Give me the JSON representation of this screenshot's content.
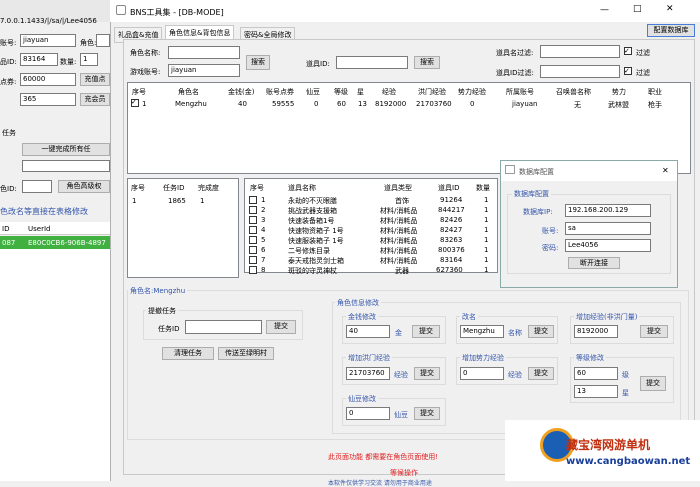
{
  "bg_window": {
    "row_ip": "7.0.0.1.1433/|/sa/|/Lee4056",
    "label_acct": "账号:",
    "acct_value": "jiayuan",
    "label_role": "角色:",
    "label_item": "品ID:",
    "item_id": "83164",
    "label_qty": "数量:",
    "qty_value": "1",
    "label_points": "点券:",
    "points_value": "60000",
    "btn_points": "充值点",
    "value_365": "365",
    "btn_charge": "充会员",
    "label_task": "任务",
    "btn_complete_all": "一键完成所有任",
    "label_roleid": "色ID:",
    "btn_role_advanced": "角色高级权",
    "tip": "色改名等直接在表格修改",
    "col_id": "ID",
    "col_userid": "UserId",
    "row_id": "087",
    "row_userid": "E80C0CB6-906B-4897"
  },
  "window": {
    "title": "BNS工具集 - [DB-MODE]",
    "btn_config_db": "配置数据库",
    "min": "—",
    "max": "□",
    "close": "✕"
  },
  "tabs": [
    {
      "label": "礼品盒&充值"
    },
    {
      "label": "角色信息&背包信息"
    },
    {
      "label": "密码&全局修改"
    }
  ],
  "search": {
    "label_role": "角色名称:",
    "label_account": "游戏账号:",
    "account_value": "jiayuan",
    "btn_search": "搜索",
    "label_itemid": "道具ID:",
    "btn_search2": "搜索",
    "label_name_filter": "道具名过滤:",
    "label_id_filter": "道具ID过滤:",
    "filter_chk": "过滤",
    "filter_chk2": "过滤"
  },
  "role_table": {
    "headers": [
      "序号",
      "角色名",
      "金钱(金)",
      "账号点券",
      "仙豆",
      "等级",
      "星",
      "经验",
      "洪门经验",
      "势力经验",
      "所属账号",
      "召唤兽名称",
      "势力",
      "职业"
    ],
    "rows": [
      [
        "1",
        "Mengzhu",
        "40",
        "59555",
        "0",
        "60",
        "13",
        "8192000",
        "21703760",
        "0",
        "jiayuan",
        "无",
        "武林盟",
        "枪手"
      ]
    ]
  },
  "task_table": {
    "headers": [
      "序号",
      "任务ID",
      "完成度"
    ],
    "rows": [
      [
        "1",
        "1865",
        "1"
      ]
    ]
  },
  "item_table": {
    "headers": [
      "序号",
      "道具名称",
      "道具类型",
      "道具ID",
      "数量"
    ],
    "rows": [
      [
        "1",
        "永劫的不灭眼膳",
        "首饰",
        "91264",
        "1"
      ],
      [
        "2",
        "挑战武器支援箱",
        "材料/消耗品",
        "844217",
        "1"
      ],
      [
        "3",
        "快速装备箱1号",
        "材料/消耗品",
        "82426",
        "1"
      ],
      [
        "4",
        "快速物资箱子 1号",
        "材料/消耗品",
        "82427",
        "1"
      ],
      [
        "5",
        "快速服装箱子 1号",
        "材料/消耗品",
        "83263",
        "1"
      ],
      [
        "6",
        "二号修炼目录",
        "材料/消耗品",
        "800376",
        "1"
      ],
      [
        "7",
        "泰天戒指灵剑士箱",
        "材料/消耗品",
        "83164",
        "1"
      ],
      [
        "8",
        "斑驳的守灵神杖",
        "武器",
        "627360",
        "1"
      ]
    ]
  },
  "dialog": {
    "title": "数据库配置",
    "group": "数据库配置",
    "label_ip": "数据库IP:",
    "ip_value": "192.168.200.129",
    "label_acct": "账号:",
    "acct_value": "sa",
    "label_pwd": "密码:",
    "pwd_value": "Lee4056",
    "btn_disconnect": "断开连接",
    "close": "✕"
  },
  "role_edit": {
    "group_label": "角色名:Mengzhu",
    "task_group": "提撤任务",
    "label_taskid": "任务ID",
    "btn_submit_task": "提交",
    "btn_clear_tasks": "清理任务",
    "btn_teleport": "传送至绿明村",
    "info_group": "角色信息修改",
    "money_label": "金钱修改",
    "money_value": "40",
    "money_unit": "金",
    "btn_money": "提交",
    "rename_label": "改名",
    "rename_value": "Mengzhu",
    "rename_unit": "名称",
    "btn_rename": "提交",
    "exp_label": "增加经验(非洪门量)",
    "exp_value": "8192000",
    "btn_exp": "提交",
    "hong_label": "增加洪门经验",
    "hong_value": "21703760",
    "hong_unit": "经验",
    "btn_hong": "提交",
    "force_label": "增加势力经验",
    "force_value": "0",
    "force_unit": "经验",
    "btn_force": "提交",
    "level_label": "等级修改",
    "level_value": "60",
    "level_unit": "级",
    "star_value": "13",
    "star_unit": "星",
    "btn_level": "提交",
    "bean_label": "仙豆修改",
    "bean_value": "0",
    "bean_unit": "仙豆",
    "btn_bean": "提交"
  },
  "footer": {
    "warning": "此页面功能 都需要在角色页面使用!",
    "ops": "等候操作",
    "bottom": "本软件仅供学习交流 请勿用于商业用途"
  },
  "watermark": {
    "text1": "藏宝湾网游单机",
    "text2": "www.cangbaowan.net"
  }
}
